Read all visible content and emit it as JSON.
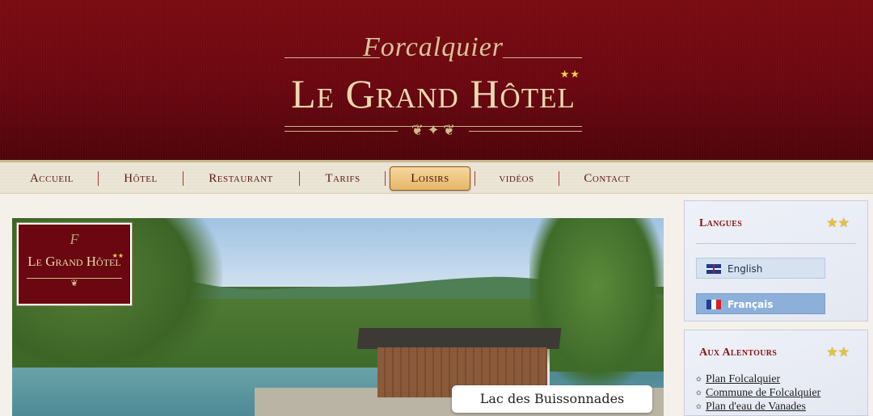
{
  "header": {
    "script": "Forcalquier",
    "title": "Le Grand Hôtel",
    "stars": "★★",
    "ornament": "❦ ✦ ❦"
  },
  "nav": {
    "items": [
      {
        "label": "Accueil"
      },
      {
        "label": "Hôtel"
      },
      {
        "label": "Restaurant"
      },
      {
        "label": "Tarifs"
      },
      {
        "label": "Loisirs"
      },
      {
        "label": "vidéos"
      },
      {
        "label": "Contact"
      }
    ],
    "active": "Loisirs"
  },
  "slideshow": {
    "badge_script": "F",
    "badge_title": "Le Grand Hôtel",
    "badge_stars": "★★",
    "badge_ornament": "❦",
    "caption": "Lac des Buissonnades"
  },
  "sidebar": {
    "languages": {
      "title": "Langues",
      "stars": "★★",
      "items": [
        {
          "label": "English",
          "flag": "uk-flag-icon"
        },
        {
          "label": "Français",
          "flag": "fr-flag-icon",
          "selected": true
        }
      ]
    },
    "around": {
      "title": "Aux Alentours",
      "stars": "★★",
      "links": [
        {
          "label": "Plan Folcalquier"
        },
        {
          "label": "Commune de Folcalquier"
        },
        {
          "label": "Plan d'eau de Vanades"
        }
      ]
    }
  },
  "colors": {
    "header_bg": "#6a0710",
    "accent_gold": "#ead9b2",
    "nav_text": "#5a1a14",
    "sidebar_title": "#8a1414"
  }
}
